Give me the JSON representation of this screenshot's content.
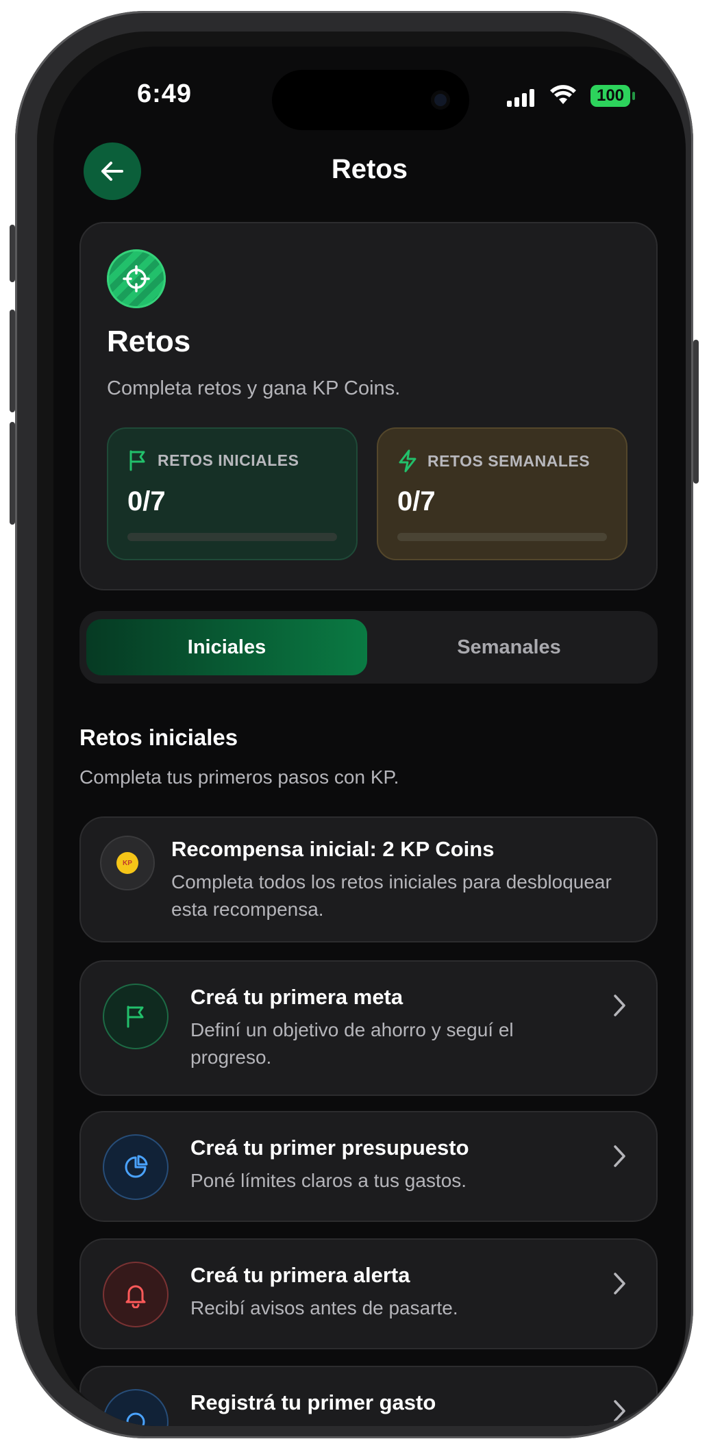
{
  "status_bar": {
    "time": "6:49",
    "battery": "100"
  },
  "header": {
    "title": "Retos"
  },
  "hero": {
    "title": "Retos",
    "subtitle": "Completa retos y gana KP Coins.",
    "stats": [
      {
        "label": "RETOS INICIALES",
        "value": "0/7",
        "progress": 0
      },
      {
        "label": "RETOS SEMANALES",
        "value": "0/7",
        "progress": 0
      }
    ]
  },
  "tabs": [
    {
      "label": "Iniciales",
      "active": true
    },
    {
      "label": "Semanales",
      "active": false
    }
  ],
  "section": {
    "title": "Retos iniciales",
    "subtitle": "Completa tus primeros pasos con KP."
  },
  "reward": {
    "title": "Recompensa inicial: 2 KP Coins",
    "description": "Completa todos los retos iniciales para desbloquear esta recompensa.",
    "coin_text": "KP"
  },
  "tasks": [
    {
      "title": "Creá tu primera meta",
      "description": "Definí un objetivo de ahorro y seguí el progreso.",
      "icon": "flag-icon",
      "color": "#22c06b"
    },
    {
      "title": "Creá tu primer presupuesto",
      "description": "Poné límites claros a tus gastos.",
      "icon": "pie-chart-icon",
      "color": "#4aa3ff"
    },
    {
      "title": "Creá tu primera alerta",
      "description": "Recibí avisos antes de pasarte.",
      "icon": "bell-icon",
      "color": "#ff5a5a"
    },
    {
      "title": "Registrá tu primer gasto",
      "description": "",
      "icon": "receipt-icon",
      "color": "#4aa3ff"
    }
  ],
  "colors": {
    "accent": "#0b5f3a",
    "brand_green": "#22c06b",
    "background": "#0b0b0c"
  }
}
